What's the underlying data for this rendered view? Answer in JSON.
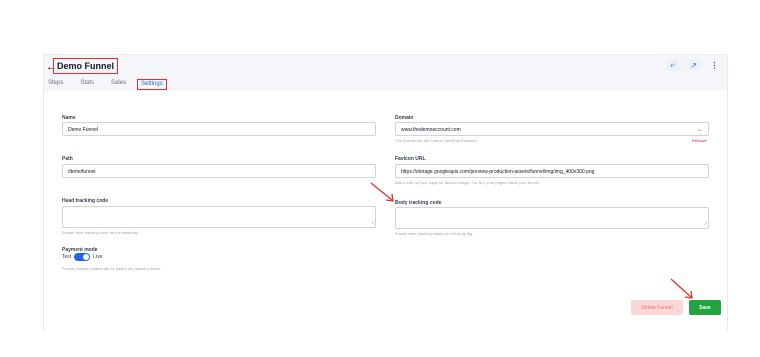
{
  "header": {
    "back_icon": "arrow-left-icon",
    "title": "Demo Funnel",
    "tabs": [
      {
        "label": "Steps"
      },
      {
        "label": "Stats"
      },
      {
        "label": "Sales"
      },
      {
        "label": "Settings",
        "active": true
      }
    ],
    "actions": [
      {
        "icon": "share-icon"
      },
      {
        "icon": "external-link-icon"
      },
      {
        "icon": "more-vertical-icon"
      }
    ]
  },
  "form": {
    "name": {
      "label": "Name",
      "value": "Demo Funnel"
    },
    "domain": {
      "label": "Domain",
      "value": "www.thedemoaccount.com",
      "hint": "The Domain for the Funnel. Add/Edit Domains",
      "remove_label": "Remove"
    },
    "path": {
      "label": "Path",
      "value": "/demofunnel"
    },
    "favicon": {
      "label": "Favicon URL",
      "value": "https://storage.googleapis.com/preview-production-assets/funnel/img/img_400x300.png",
      "hint": "Add a URL to your page for favicon image. For ALL your pages inside your funnel."
    },
    "head_tracking": {
      "label": "Head tracking code",
      "hint": "Funnel wide tracking code for the head tag"
    },
    "body_tracking": {
      "label": "Body tracking code",
      "hint": "Funnel wide tracking codes for the body tag"
    },
    "payment_mode": {
      "label": "Payment mode",
      "left_option": "Test",
      "right_option": "Live",
      "enabled": true,
      "hint": "Funnel payment status will be based on payment mode."
    }
  },
  "buttons": {
    "delete_label": "Delete Funnel",
    "save_label": "Save"
  },
  "colors": {
    "accent": "#2563eb",
    "highlight_red": "#e0322b",
    "save_green": "#22a541",
    "delete_bg": "#fbd7d7"
  }
}
